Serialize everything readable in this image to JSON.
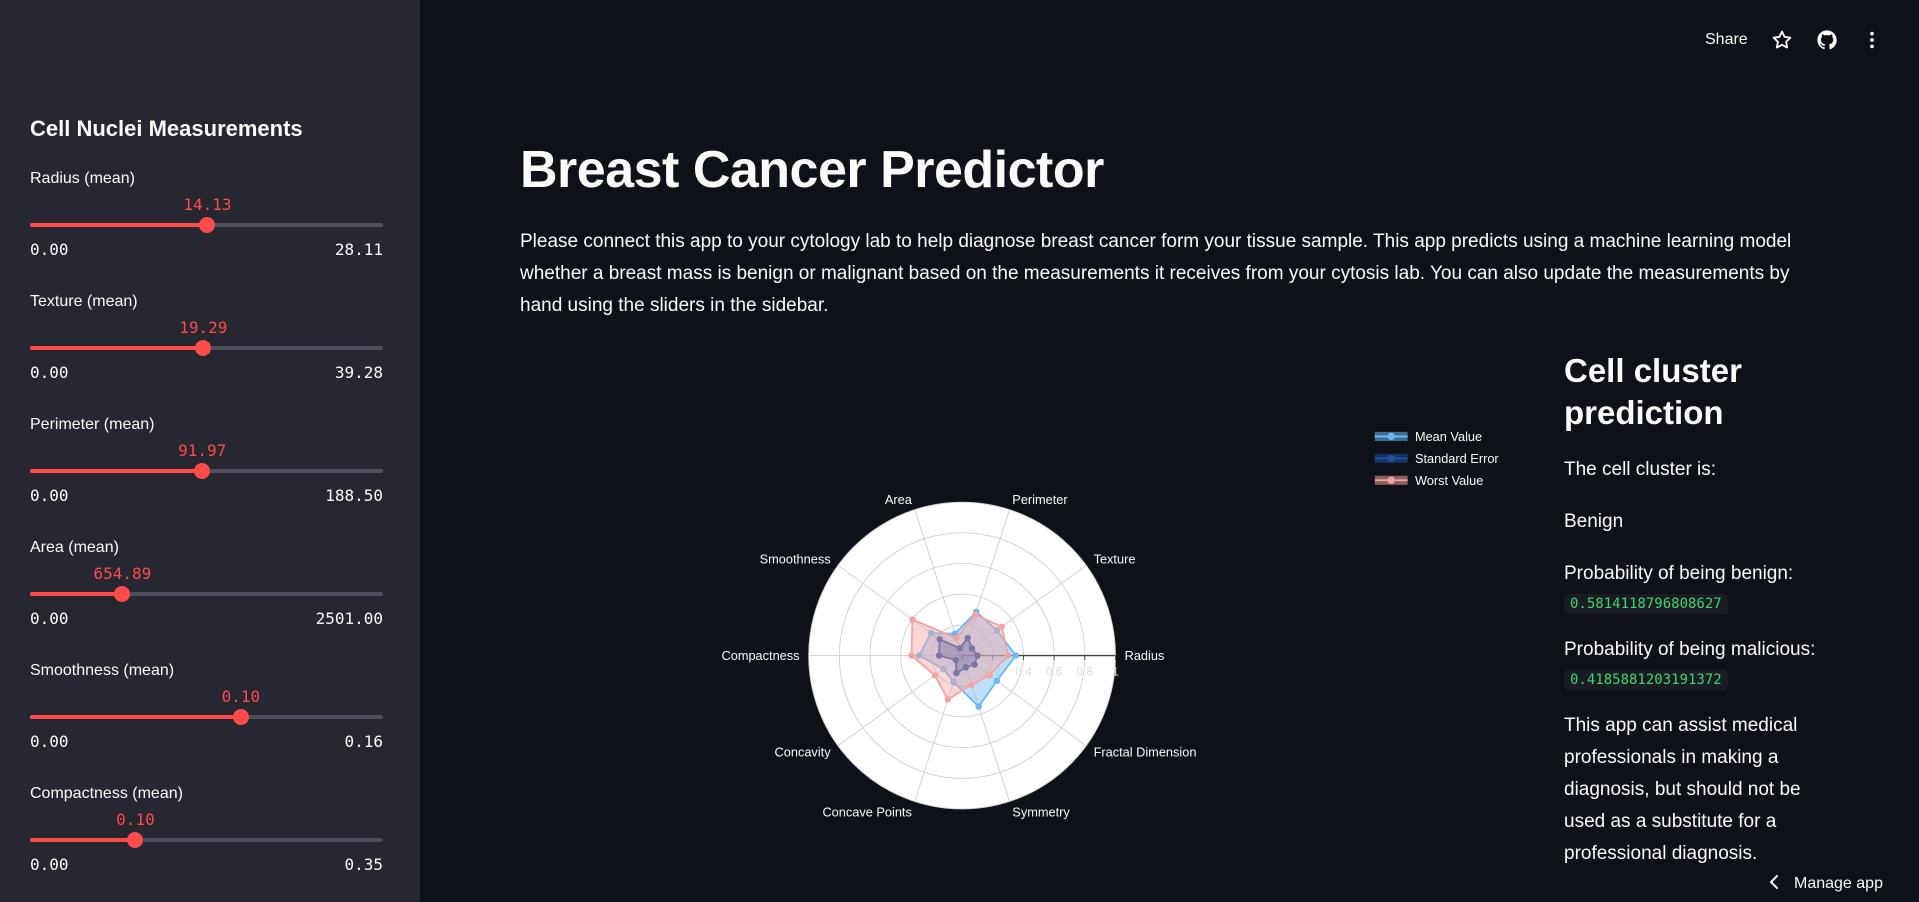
{
  "colors": {
    "background": "#0e1117",
    "sidebar": "#262730",
    "accent": "#ff4b4b",
    "code_green": "#3dd56d"
  },
  "sidebar": {
    "title": "Cell Nuclei Measurements",
    "sliders": [
      {
        "label": "Radius (mean)",
        "value": "14.13",
        "min": "0.00",
        "max": "28.11",
        "fraction": 0.5027
      },
      {
        "label": "Texture (mean)",
        "value": "19.29",
        "min": "0.00",
        "max": "39.28",
        "fraction": 0.4911
      },
      {
        "label": "Perimeter (mean)",
        "value": "91.97",
        "min": "0.00",
        "max": "188.50",
        "fraction": 0.4879
      },
      {
        "label": "Area (mean)",
        "value": "654.89",
        "min": "0.00",
        "max": "2501.00",
        "fraction": 0.2618
      },
      {
        "label": "Smoothness (mean)",
        "value": "0.10",
        "min": "0.00",
        "max": "0.16",
        "fraction": 0.5975
      },
      {
        "label": "Compactness (mean)",
        "value": "0.10",
        "min": "0.00",
        "max": "0.35",
        "fraction": 0.2987
      }
    ]
  },
  "toolbar": {
    "share_label": "Share",
    "star_icon": "star-icon",
    "github_icon": "github-icon",
    "menu_icon": "more-vertical-icon"
  },
  "main": {
    "title": "Breast Cancer Predictor",
    "description": "Please connect this app to your cytology lab to help diagnose breast cancer form your tissue sample. This app predicts using a machine learning model whether a breast mass is benign or malignant based on the measurements it receives from your cytosis lab. You can also update the measurements by hand using the sliders in the sidebar."
  },
  "chart_data": {
    "type": "radar",
    "categories": [
      "Radius",
      "Texture",
      "Perimeter",
      "Area",
      "Smoothness",
      "Compactness",
      "Concavity",
      "Concave Points",
      "Symmetry",
      "Fractal Dimension"
    ],
    "radial_ticks": [
      "0",
      "0.2",
      "0.4",
      "0.6",
      "0.8",
      "1"
    ],
    "rlim": [
      0,
      1
    ],
    "series": [
      {
        "name": "Mean Value",
        "color": "#6cb8f2",
        "values": [
          0.35,
          0.28,
          0.3,
          0.15,
          0.25,
          0.28,
          0.15,
          0.18,
          0.35,
          0.28
        ]
      },
      {
        "name": "Standard Error",
        "color": "#1f4fa0",
        "values": [
          0.1,
          0.08,
          0.12,
          0.05,
          0.18,
          0.15,
          0.05,
          0.12,
          0.08,
          0.1
        ]
      },
      {
        "name": "Worst Value",
        "color": "#f4a3a3",
        "values": [
          0.3,
          0.32,
          0.28,
          0.12,
          0.4,
          0.33,
          0.22,
          0.3,
          0.2,
          0.22
        ]
      }
    ],
    "legend_position": "top-right"
  },
  "prediction": {
    "heading": "Cell cluster prediction",
    "cluster_label": "The cell cluster is:",
    "result": "Benign",
    "benign_label": "Probability of being benign:",
    "benign_value": "0.5814118796808627",
    "malicious_label": "Probability of being malicious:",
    "malicious_value": "0.4185881203191372",
    "disclaimer": "This app can assist medical professionals in making a diagnosis, but should not be used as a substitute for a professional diagnosis."
  },
  "footer": {
    "manage_label": "Manage app"
  }
}
